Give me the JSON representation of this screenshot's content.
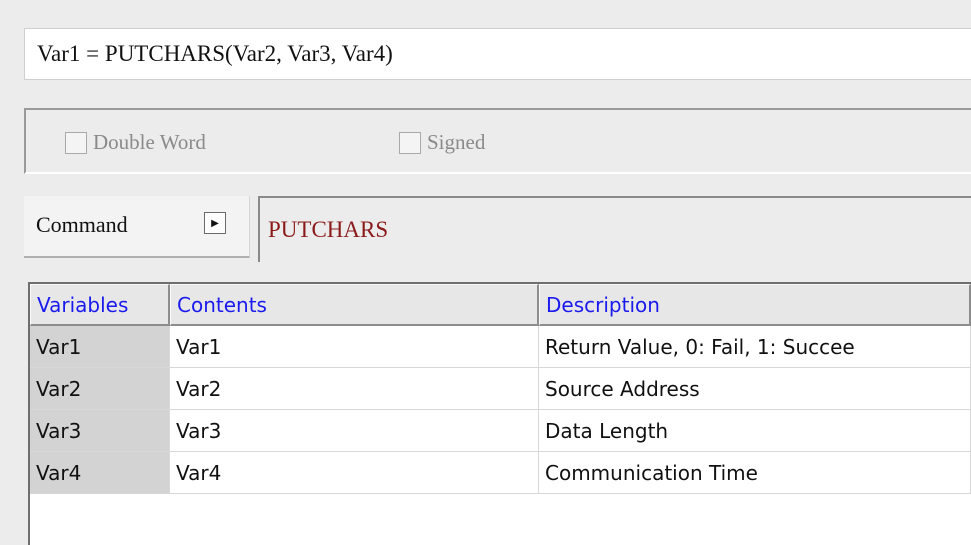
{
  "formula": "Var1 = PUTCHARS(Var2, Var3, Var4)",
  "options": {
    "double_word": {
      "label": "Double Word",
      "checked": false
    },
    "signed": {
      "label": "Signed",
      "checked": false
    }
  },
  "command": {
    "label": "Command",
    "value": "PUTCHARS",
    "arrow_icon": "triangle-right-icon"
  },
  "table": {
    "headers": [
      "Variables",
      "Contents",
      "Description"
    ],
    "rows": [
      {
        "variable": "Var1",
        "contents": "Var1",
        "description": "Return Value, 0: Fail, 1: Succee"
      },
      {
        "variable": "Var2",
        "contents": "Var2",
        "description": "Source Address"
      },
      {
        "variable": "Var3",
        "contents": "Var3",
        "description": "Data Length"
      },
      {
        "variable": "Var4",
        "contents": "Var4",
        "description": "Communication Time"
      }
    ]
  },
  "colors": {
    "header_text": "#1a1aee",
    "command_value": "#8b1a1a",
    "background": "#ececec"
  }
}
